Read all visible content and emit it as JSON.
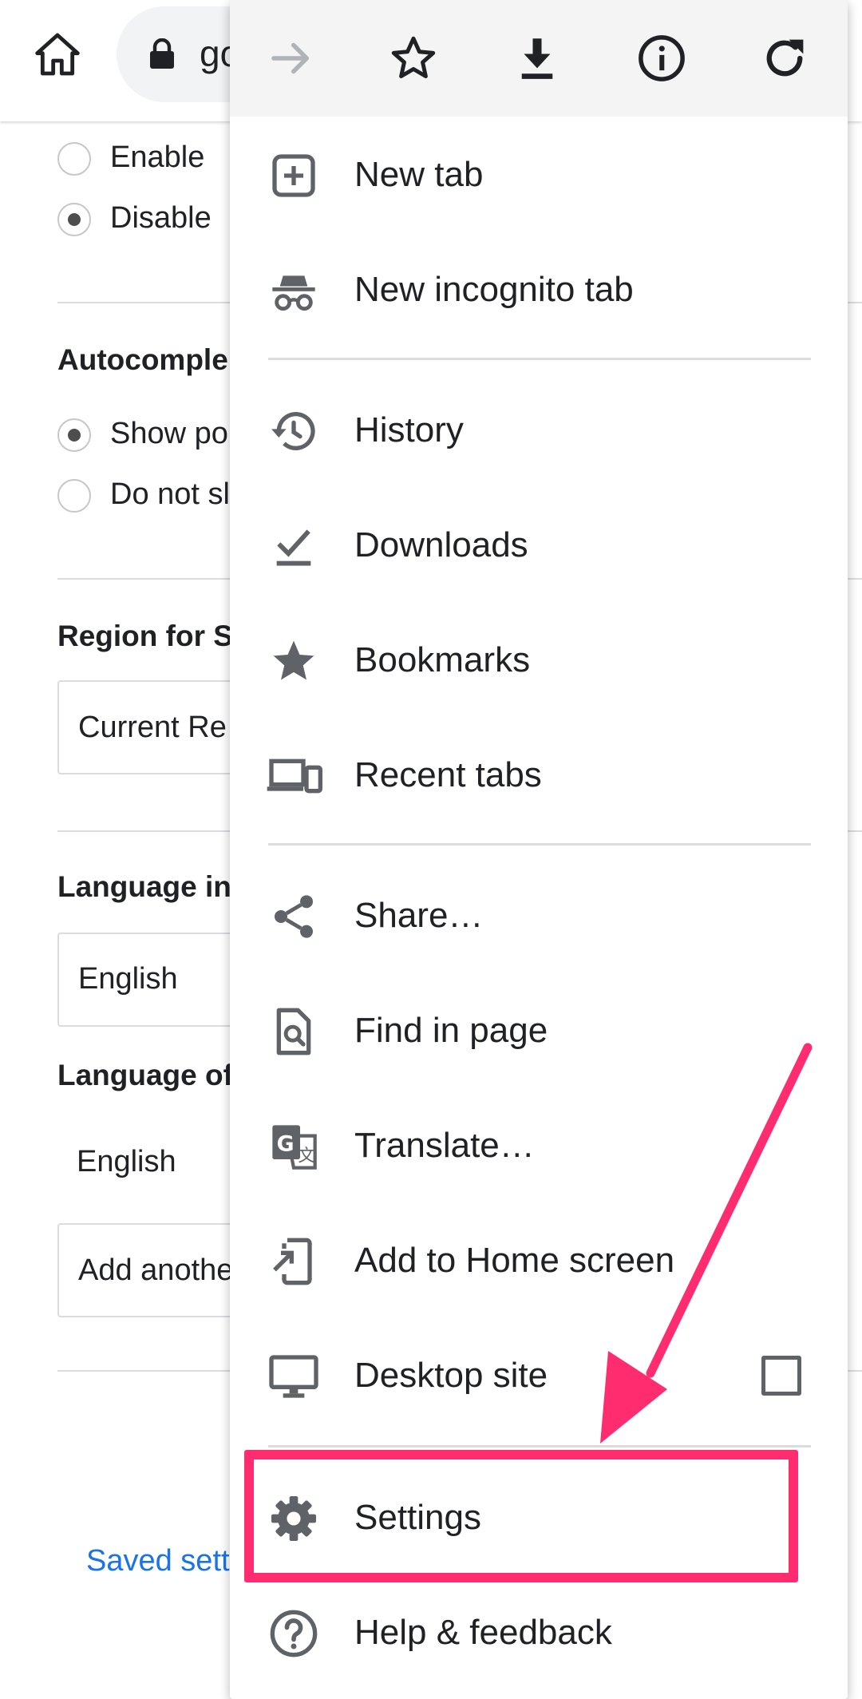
{
  "toolbar": {
    "url_partial": "go"
  },
  "page": {
    "safe_search_options": [
      {
        "label": "Enable",
        "checked": false
      },
      {
        "label": "Disable",
        "checked": true
      }
    ],
    "autocomplete_title": "Autocomple",
    "autocomplete_options": [
      {
        "label": "Show po",
        "checked": true
      },
      {
        "label": "Do not sl",
        "checked": false
      }
    ],
    "region_title": "Region for S",
    "region_value": "Current Re",
    "language_interface_title": "Language in",
    "language_interface_value": "English",
    "language_other_title": "Language of",
    "language_other_value": "English",
    "add_language": "Add anothe",
    "saved_settings": "Saved sett"
  },
  "menu": {
    "items": [
      {
        "label": "New tab",
        "icon": "new-tab-icon"
      },
      {
        "label": "New incognito tab",
        "icon": "incognito-icon"
      },
      {
        "label": "History",
        "icon": "history-icon"
      },
      {
        "label": "Downloads",
        "icon": "downloads-icon"
      },
      {
        "label": "Bookmarks",
        "icon": "bookmarks-star-icon"
      },
      {
        "label": "Recent tabs",
        "icon": "devices-icon"
      },
      {
        "label": "Share…",
        "icon": "share-icon"
      },
      {
        "label": "Find in page",
        "icon": "find-in-page-icon"
      },
      {
        "label": "Translate…",
        "icon": "translate-icon"
      },
      {
        "label": "Add to Home screen",
        "icon": "add-to-home-icon"
      },
      {
        "label": "Desktop site",
        "icon": "desktop-icon",
        "checked": false
      },
      {
        "label": "Settings",
        "icon": "gear-icon"
      },
      {
        "label": "Help & feedback",
        "icon": "help-icon"
      }
    ]
  },
  "colors": {
    "highlight": "#ff2d6f",
    "link": "#1a73e8",
    "icon_gray": "#5f6368"
  }
}
